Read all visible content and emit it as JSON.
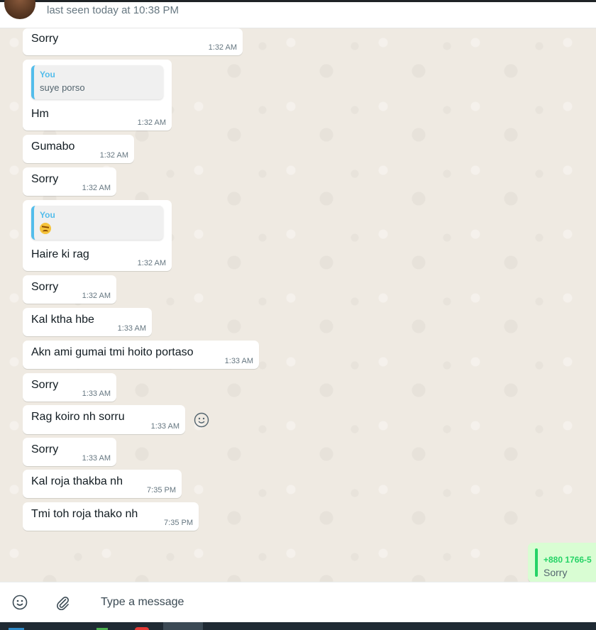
{
  "header": {
    "last_seen": "last seen today at 10:38 PM"
  },
  "messages": [
    {
      "text": "Sorry",
      "time": "1:32 AM"
    },
    {
      "text": "Hm",
      "time": "1:32 AM",
      "quote": {
        "author": "You",
        "text": "suye porso"
      }
    },
    {
      "text": "Gumabo",
      "time": "1:32 AM"
    },
    {
      "text": "Sorry",
      "time": "1:32 AM"
    },
    {
      "text": "Haire ki rag",
      "time": "1:32 AM",
      "quote": {
        "author": "You",
        "emoji": "unamused-face-emoji"
      }
    },
    {
      "text": "Sorry",
      "time": "1:32 AM"
    },
    {
      "text": "Kal ktha hbe",
      "time": "1:33 AM"
    },
    {
      "text": "Akn ami gumai tmi hoito portaso",
      "time": "1:33 AM"
    },
    {
      "text": "Sorry",
      "time": "1:33 AM"
    },
    {
      "text": "Rag koiro nh sorru",
      "time": "1:33 AM"
    },
    {
      "text": "Sorry",
      "time": "1:33 AM"
    },
    {
      "text": "Kal roja thakba nh",
      "time": "7:35 PM"
    },
    {
      "text": "Tmi toh roja thako nh",
      "time": "7:35 PM"
    }
  ],
  "outgoing_partial": {
    "quote_author": "+880 1766-5",
    "quote_text": "Sorry"
  },
  "composer": {
    "placeholder": "Type a message",
    "emoji_icon": "smiley-icon",
    "attach_icon": "paperclip-icon"
  },
  "colors": {
    "chat_bg": "#efeae2",
    "bubble_in": "#ffffff",
    "bubble_out": "#d9fdd3",
    "quote_accent": "#53bdeb",
    "quote_accent_out": "#25d366",
    "text_primary": "#111b21",
    "text_secondary": "#667781"
  }
}
